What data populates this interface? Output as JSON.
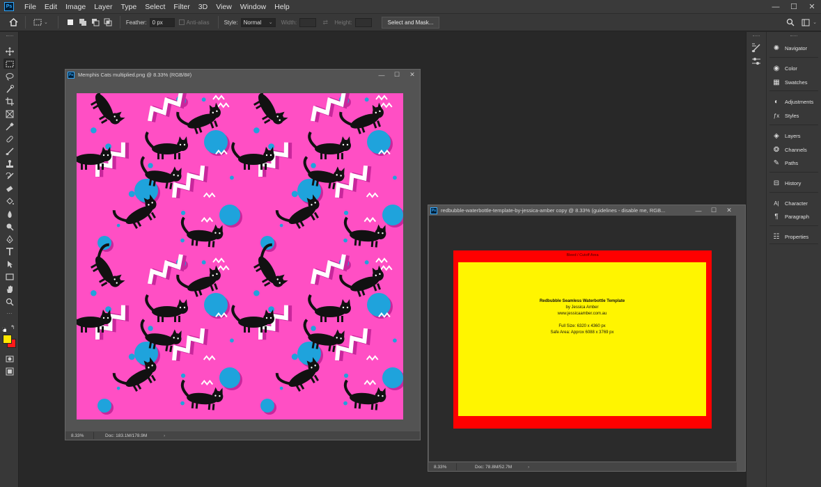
{
  "app": {
    "logo": "Ps"
  },
  "menu": [
    "File",
    "Edit",
    "Image",
    "Layer",
    "Type",
    "Select",
    "Filter",
    "3D",
    "View",
    "Window",
    "Help"
  ],
  "window_controls": {
    "minimize": "—",
    "maximize": "☐",
    "close": "✕"
  },
  "options": {
    "feather_label": "Feather:",
    "feather_value": "0 px",
    "antialias_label": "Anti-alias",
    "style_label": "Style:",
    "style_value": "Normal",
    "width_label": "Width:",
    "height_label": "Height:",
    "select_mask_button": "Select and Mask..."
  },
  "panels": [
    {
      "label": "Navigator",
      "icon": "navigator-icon"
    },
    {
      "label": "Color",
      "icon": "color-icon"
    },
    {
      "label": "Swatches",
      "icon": "swatches-icon"
    },
    {
      "label": "Adjustments",
      "icon": "adjustments-icon"
    },
    {
      "label": "Styles",
      "icon": "styles-icon"
    },
    {
      "label": "Layers",
      "icon": "layers-icon"
    },
    {
      "label": "Channels",
      "icon": "channels-icon"
    },
    {
      "label": "Paths",
      "icon": "paths-icon"
    },
    {
      "label": "History",
      "icon": "history-icon"
    },
    {
      "label": "Character",
      "icon": "character-icon"
    },
    {
      "label": "Paragraph",
      "icon": "paragraph-icon"
    },
    {
      "label": "Properties",
      "icon": "properties-icon"
    }
  ],
  "doc1": {
    "title": "Memphis Cats multiplied.png @ 8.33% (RGB/8#)",
    "zoom": "8.33%",
    "doc_size": "Doc: 183.1M/178.9M",
    "canvas_color": "#ff4fc4"
  },
  "doc2": {
    "title": "redbubble-waterbottle-template-by-jessica-amber copy @ 8.33% (guidelines - disable me, RGB...",
    "zoom": "8.33%",
    "doc_size": "Doc: 78.8M/52.7M",
    "bleed_label": "Bleed / Cutoff Area",
    "template_title": "Redbubble Seamless Waterbottle Template",
    "author": "by Jessica Amber",
    "website": "www.jessicaamber.com.au",
    "full_size": "Full Size: 6320 x 4360 px",
    "safe_area": "Safe Area: Approx 6088 x 3769 px",
    "bleed_color": "#ff0000",
    "safe_color": "#fff500"
  },
  "colors": {
    "foreground": "#ffe600",
    "background": "#ff1a1a"
  }
}
